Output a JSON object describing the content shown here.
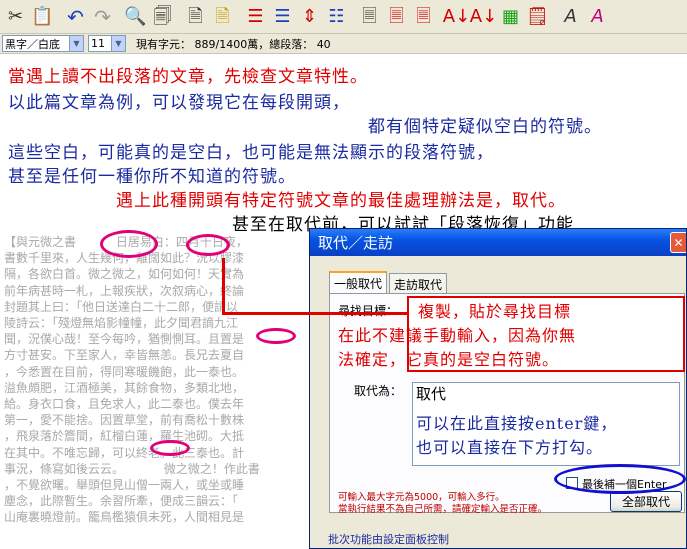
{
  "toolbar": {
    "icons": [
      "scissors-icon",
      "paste-icon",
      "undo-icon",
      "redo-icon",
      "search-icon",
      "replace-icon",
      "document-icon",
      "document-yellow-icon",
      "indent-red-icon",
      "indent-blue-icon",
      "line-spacing-icon",
      "list-icon",
      "page-icon",
      "page-red-icon",
      "page-red2-icon",
      "text-to-down-icon",
      "text-to-down2-icon",
      "table-green-icon",
      "note-icon",
      "brush-a-icon",
      "pen-a-icon"
    ]
  },
  "format_bar": {
    "color_scheme": "黑字／白底",
    "font_size": "11",
    "status": "現有字元： 889/1400萬，總段落： 40"
  },
  "instructions": {
    "line1": "當遇上讀不出段落的文章，先檢查文章特性。",
    "line2": "以此篇文章為例，可以發現它在每段開頭，",
    "line3": "都有個特定疑似空白的符號。",
    "line4": "這些空白，可能真的是空白，也可能是無法顯示的段落符號，",
    "line5": "甚至是任何一種你所不知道的符號。",
    "line6": "遇上此種開頭有特定符號文章的最佳處理辦法是，取代。",
    "line7": "甚至在取代前，可以試試「段落恢復」功能"
  },
  "background_text": [
    "【與元微之書 　　　日居易白：四月十日夜，",
    "書數千里來，人生幾何，離闊如此？況以膠漆",
    "隔，各欲白首。微之微之，如何如何！天實為",
    "前年病甚時一札，上報疾狀，次叙病心，終論",
    "封題其上曰：「他日送達白二十二郎，便請以",
    "陵詩云：「殘燈無焰影幢幢，此夕聞君謫九江",
    "聞，況僕心哉！至今每吟，猶惻惻耳。且置是",
    "方寸甚安。下至家人，幸皆無恙。長兄去夏自",
    "，今悉置在目前，得同寒暖饑飽，此一泰也。",
    "溢魚頗肥，江酒極美，其餘食物，多類北地，",
    "給。身衣口食，且免求人，此二泰也。僕去年",
    "第一，愛不能捨。因置草堂，前有喬松十數株",
    "，飛泉落於簷間，紅榴白蓮，羅生池砌。大抵",
    "在其中。不唯忘歸，可以終老。此三泰也。計",
    "事況，條寫如後云云。 　　　微之微之！作此書",
    "，不覺欲曙。舉頭但見山僧一兩人，或坐或睡",
    "塵念，此際暫生。余習所牽，便成三韻云：「",
    "山庵裏曉燈前。籠鳥檻猿俱未死，人間相見是"
  ],
  "dialog": {
    "title": "取代／走訪",
    "tab_replace": "一般取代",
    "tab_visit": "走訪取代",
    "find_label": "尋找目標：",
    "replace_label": "取代為：",
    "replace_value": "取代",
    "checkbox_label": "最後補一個Enter",
    "note_line1": "可輸入最大字元為5000，可輸入多行。",
    "note_line2": "當執行結果不為自己所需，請確定輸入是否正確。",
    "replace_all_button": "全部取代",
    "footer_link": "批次功能由設定面板控制"
  },
  "annotations": {
    "copy_line1": "複製，貼於尋找目標",
    "copy_line2": "在此不建議手動輸入，因為你無",
    "copy_line3": "法確定，它真的是空白符號。",
    "enter_line1": "可以在此直接按enter鍵，",
    "enter_line2": "也可以直接在下方打勾。"
  },
  "colors": {
    "annotation_red": "#e00000",
    "instruction_blue": "#1a2aa0",
    "ellipse_magenta": "#e0007a",
    "ellipse_blue": "#1010d0"
  }
}
